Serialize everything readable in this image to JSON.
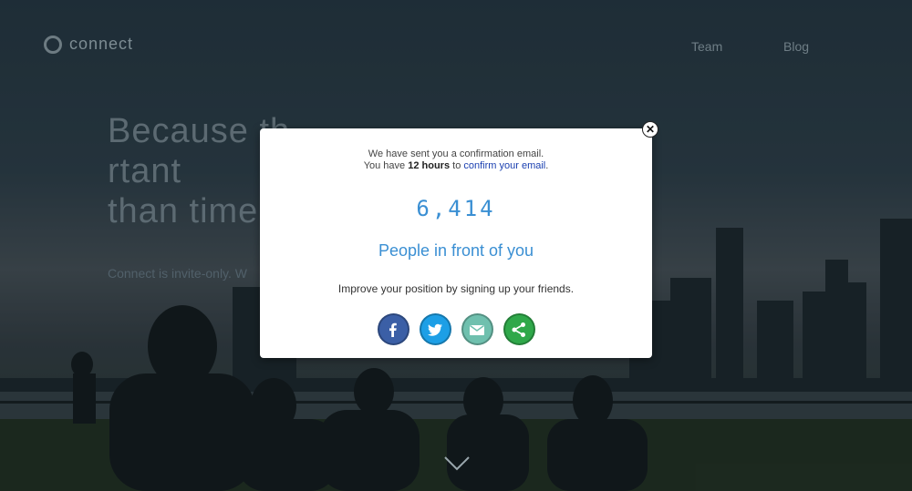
{
  "header": {
    "logo_text": "connect",
    "nav": {
      "team": "Team",
      "blog": "Blog"
    }
  },
  "hero": {
    "title_visible_left": "Because th",
    "title_visible_right": "rtant",
    "title_line2_visible": "than time",
    "subtitle_visible": "Connect is invite-only. W"
  },
  "modal": {
    "line1": "We have sent you a confirmation email.",
    "line2_prefix": "You have ",
    "line2_hours": "12 hours",
    "line2_mid": " to ",
    "line2_link": "confirm your email",
    "line2_suffix": ".",
    "count": "6,414",
    "count_label": "People in front of you",
    "improve_text": "Improve your position by signing up your friends.",
    "share_buttons": [
      {
        "name": "facebook",
        "icon": "facebook-icon",
        "color": "#3b5fa6"
      },
      {
        "name": "twitter",
        "icon": "twitter-icon",
        "color": "#1d9fe6"
      },
      {
        "name": "email",
        "icon": "email-icon",
        "color": "#6fc0ae"
      },
      {
        "name": "share",
        "icon": "share-icon",
        "color": "#2fa84a"
      }
    ]
  }
}
